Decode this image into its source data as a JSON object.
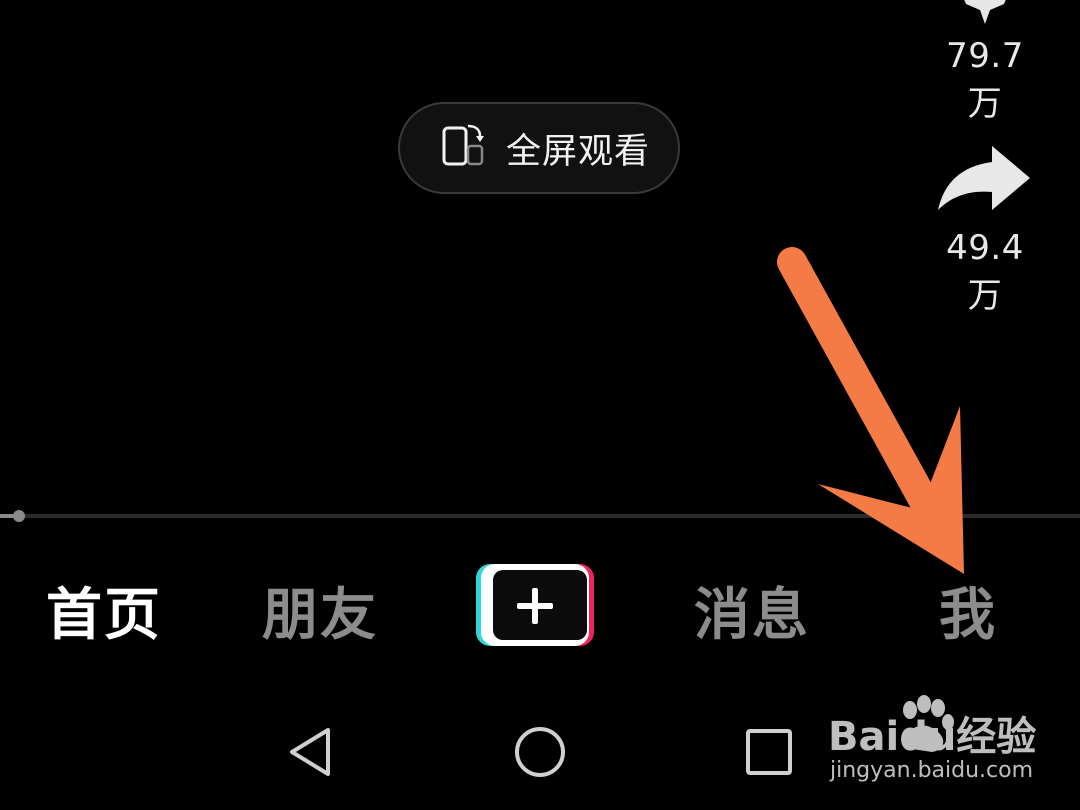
{
  "actions": {
    "collect": {
      "count": "79.7万",
      "icon": "star-icon"
    },
    "share": {
      "count": "49.4万",
      "icon": "share-arrow-icon"
    }
  },
  "fullscreen": {
    "label": "全屏观看",
    "icon": "rotate-phone-icon"
  },
  "progress": {
    "fraction": 0.018
  },
  "tabbar": {
    "home": "首页",
    "friends": "朋友",
    "create_icon": "plus-icon",
    "messages": "消息",
    "me": "我",
    "active": "home"
  },
  "system_nav": {
    "back": "back-triangle-icon",
    "home": "home-circle-icon",
    "recent": "recent-square-icon"
  },
  "annotation": {
    "color": "#f47a46",
    "points_to": "me"
  },
  "watermark": {
    "brand": "Baidu经验",
    "url": "jingyan.baidu.com"
  },
  "colors": {
    "background": "#000000",
    "tab_inactive": "#8c8c8c",
    "tab_active": "#ffffff",
    "cyan": "#33d6d6",
    "pink": "#f0245a"
  }
}
